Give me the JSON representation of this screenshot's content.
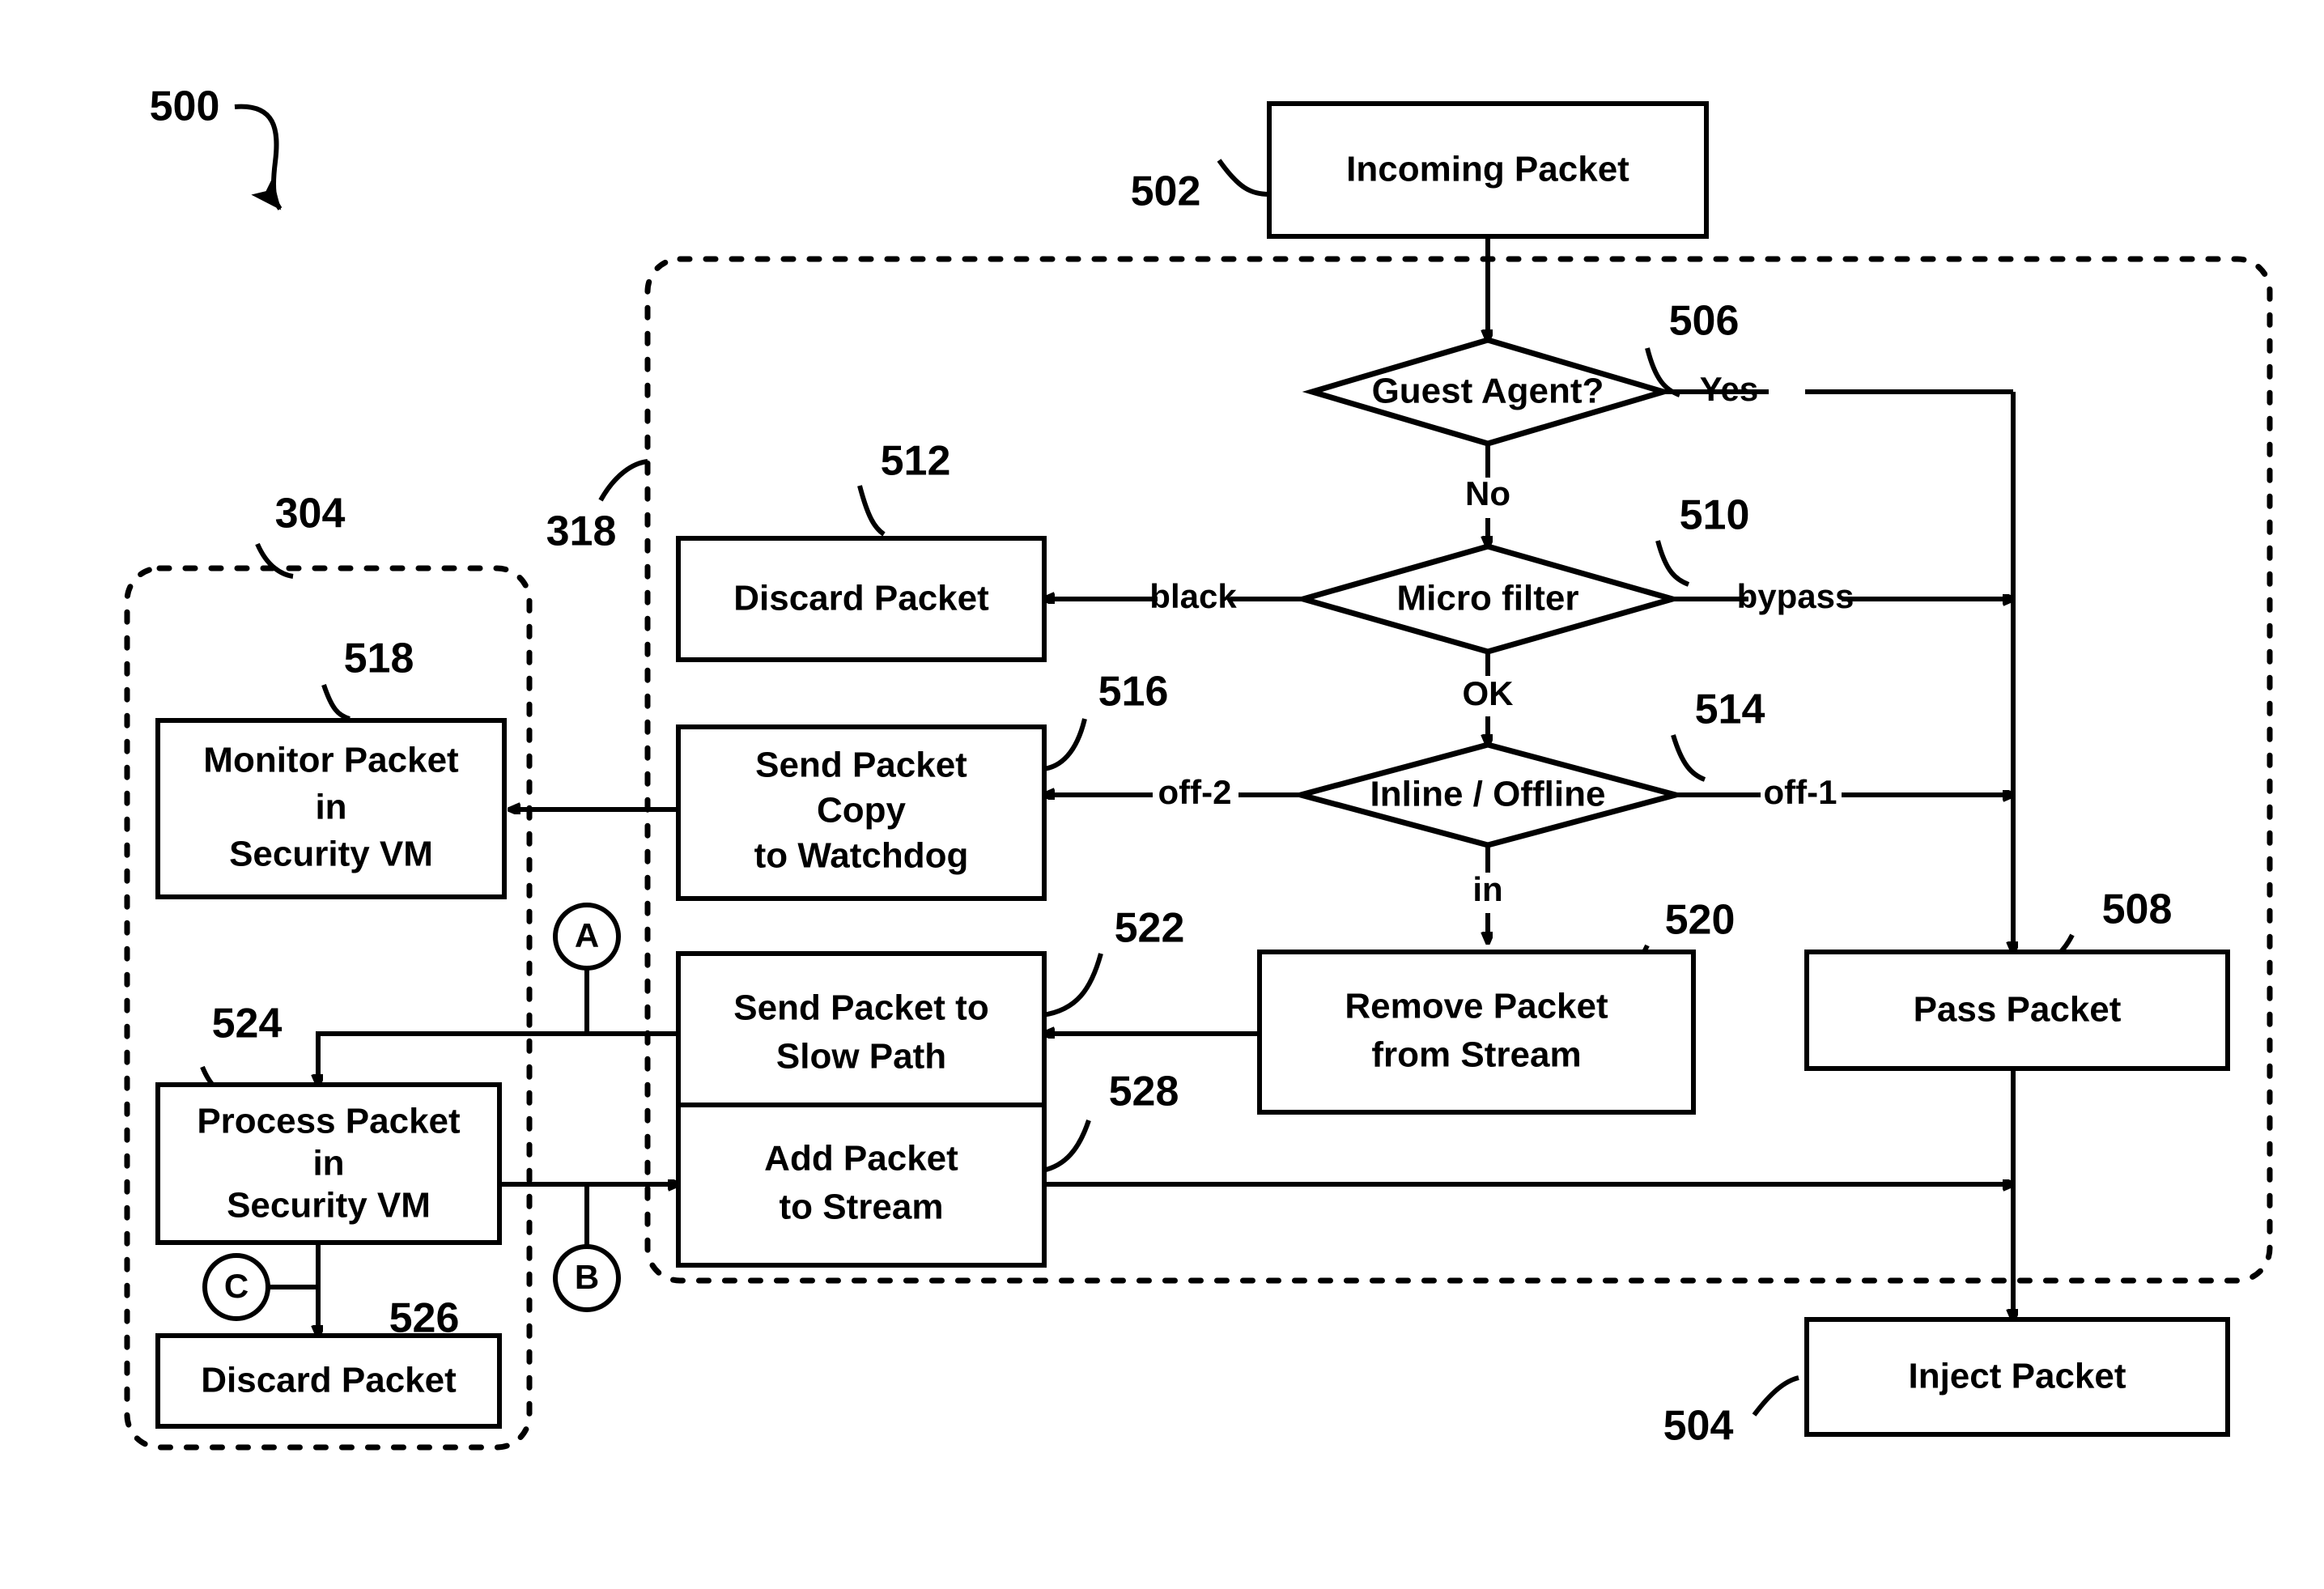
{
  "figure": {
    "number": "500",
    "title": "Packet processing flow diagram"
  },
  "groups": [
    {
      "id": "304",
      "ref": "304",
      "name": "security-vm-group"
    },
    {
      "id": "318",
      "ref": "318",
      "name": "hypervisor-group"
    }
  ],
  "nodes": {
    "incoming_packet": {
      "ref": "502",
      "label": "Incoming Packet",
      "shape": "box"
    },
    "guest_agent": {
      "ref": "506",
      "label": "Guest Agent?",
      "shape": "diamond"
    },
    "micro_filter": {
      "ref": "510",
      "label": "Micro filter",
      "shape": "diamond"
    },
    "inline_offline": {
      "ref": "514",
      "label": "Inline / Offline",
      "shape": "diamond"
    },
    "discard_packet_512": {
      "ref": "512",
      "label": "Discard Packet",
      "shape": "box"
    },
    "send_copy_watchdog": {
      "ref": "516",
      "label_lines": [
        "Send Packet",
        "Copy",
        "to Watchdog"
      ],
      "shape": "box"
    },
    "monitor_packet": {
      "ref": "518",
      "label_lines": [
        "Monitor Packet",
        "in",
        "Security VM"
      ],
      "shape": "box"
    },
    "remove_from_stream": {
      "ref": "520",
      "label_lines": [
        "Remove Packet",
        "from Stream"
      ],
      "shape": "box"
    },
    "send_slow_path": {
      "ref": "522",
      "label_lines": [
        "Send Packet to",
        "Slow Path"
      ],
      "shape": "box"
    },
    "process_packet": {
      "ref": "524",
      "label_lines": [
        "Process Packet",
        "in",
        "Security VM"
      ],
      "shape": "box"
    },
    "discard_packet_526": {
      "ref": "526",
      "label": "Discard Packet",
      "shape": "box"
    },
    "add_to_stream": {
      "ref": "528",
      "label_lines": [
        "Add Packet",
        "to Stream"
      ],
      "shape": "box"
    },
    "pass_packet": {
      "ref": "508",
      "label": "Pass Packet",
      "shape": "box"
    },
    "inject_packet": {
      "ref": "504",
      "label": "Inject Packet",
      "shape": "box"
    }
  },
  "edge_labels": {
    "guest_agent_yes": "Yes",
    "guest_agent_no": "No",
    "micro_filter_black": "black",
    "micro_filter_bypass": "bypass",
    "micro_filter_ok": "OK",
    "inline_off2": "off-2",
    "inline_off1": "off-1",
    "inline_in": "in"
  },
  "connectors": [
    {
      "id": "A",
      "label": "A",
      "name": "offpage-connector-a"
    },
    {
      "id": "B",
      "label": "B",
      "name": "offpage-connector-b"
    },
    {
      "id": "C",
      "label": "C",
      "name": "offpage-connector-c"
    }
  ],
  "colors": {
    "stroke": "#000000",
    "fill": "#ffffff"
  }
}
